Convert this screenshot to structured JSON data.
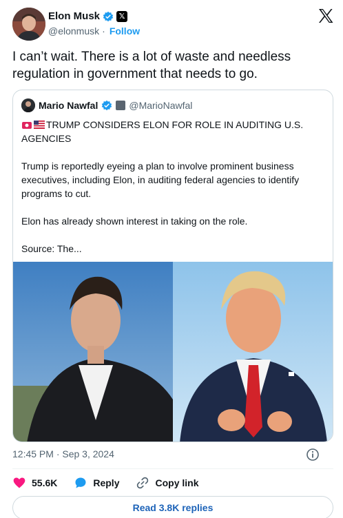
{
  "author": {
    "display_name": "Elon Musk",
    "handle": "@elonmusk",
    "separator": "·",
    "follow_label": "Follow",
    "x_badge_glyph": "𝕏"
  },
  "tweet": {
    "text": "I can’t wait. There is a lot of waste and needless regulation in government that needs to go.",
    "timestamp": "12:45 PM · Sep 3, 2024"
  },
  "quoted_tweet": {
    "display_name": "Mario Nawfal",
    "handle": "@MarioNawfal",
    "headline": "TRUMP CONSIDERS ELON FOR ROLE IN AUDITING U.S. AGENCIES",
    "paragraph_1": "Trump is reportedly eyeing a plan to involve prominent business executives, including Elon, in auditing federal agencies to identify programs to cut.",
    "paragraph_2": "Elon has already shown interest in taking on the role.",
    "paragraph_3": "Source: The..."
  },
  "actions": {
    "likes": "55.6K",
    "reply_label": "Reply",
    "copy_link_label": "Copy link"
  },
  "replies_button": "Read 3.8K replies",
  "colors": {
    "accent": "#1d9bf0",
    "like": "#f91880",
    "text": "#0f1419",
    "muted": "#536471",
    "border": "#cfd9de"
  }
}
